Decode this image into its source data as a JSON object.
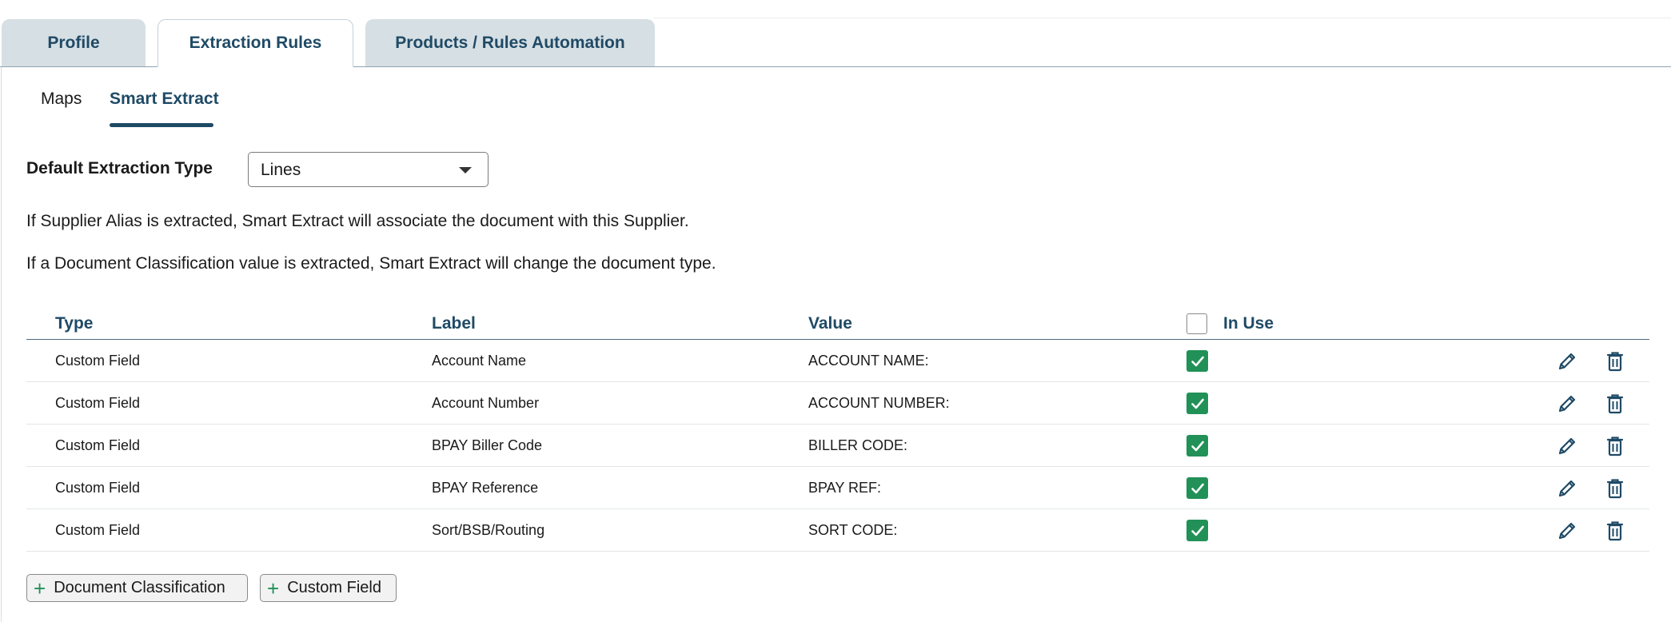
{
  "tabs": [
    {
      "label": "Profile",
      "active": false
    },
    {
      "label": "Extraction Rules",
      "active": true
    },
    {
      "label": "Products / Rules Automation",
      "active": false
    }
  ],
  "subtabs": [
    {
      "label": "Maps",
      "active": false
    },
    {
      "label": "Smart Extract",
      "active": true
    }
  ],
  "default_extraction": {
    "label": "Default Extraction Type",
    "value": "Lines"
  },
  "info": [
    "If Supplier Alias is extracted, Smart Extract will associate the document with this Supplier.",
    "If a Document Classification value is extracted, Smart Extract will change the document type."
  ],
  "table": {
    "headers": {
      "type": "Type",
      "label": "Label",
      "value": "Value",
      "in_use": "In Use"
    },
    "rows": [
      {
        "type": "Custom Field",
        "label": "Account Name",
        "value": "ACCOUNT NAME:",
        "in_use": true
      },
      {
        "type": "Custom Field",
        "label": "Account Number",
        "value": "ACCOUNT NUMBER:",
        "in_use": true
      },
      {
        "type": "Custom Field",
        "label": "BPAY Biller Code",
        "value": "BILLER CODE:",
        "in_use": true
      },
      {
        "type": "Custom Field",
        "label": "BPAY Reference",
        "value": "BPAY REF:",
        "in_use": true
      },
      {
        "type": "Custom Field",
        "label": "Sort/BSB/Routing",
        "value": "SORT CODE:",
        "in_use": true
      }
    ]
  },
  "actions": {
    "add_document_classification": "Document Classification",
    "add_custom_field": "Custom Field"
  },
  "colors": {
    "primary": "#1f4a66",
    "check_green": "#219157",
    "tab_inactive_bg": "#d6dfe3"
  },
  "icons": {
    "edit": "pencil-icon",
    "delete": "trash-icon",
    "add": "plus-icon",
    "dropdown": "caret-down-icon",
    "checked": "check-icon"
  }
}
